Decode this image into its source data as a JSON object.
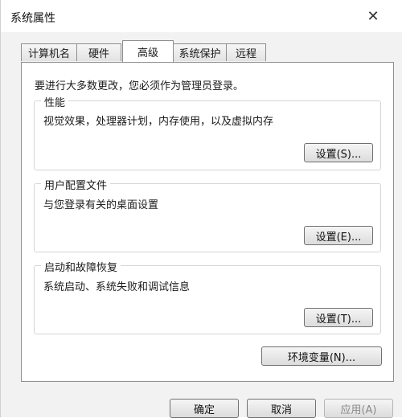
{
  "window": {
    "title": "系统属性",
    "close_glyph": "✕"
  },
  "tabs": [
    {
      "label": "计算机名"
    },
    {
      "label": "硬件"
    },
    {
      "label": "高级"
    },
    {
      "label": "系统保护"
    },
    {
      "label": "远程"
    }
  ],
  "active_tab": "高级",
  "note": "要进行大多数更改，您必须作为管理员登录。",
  "groups": {
    "performance": {
      "title": "性能",
      "description": "视觉效果，处理器计划，内存使用，以及虚拟内存",
      "button": "设置(S)..."
    },
    "profiles": {
      "title": "用户配置文件",
      "description": "与您登录有关的桌面设置",
      "button": "设置(E)..."
    },
    "startup": {
      "title": "启动和故障恢复",
      "description": "系统启动、系统失败和调试信息",
      "button": "设置(T)..."
    }
  },
  "env_button": "环境变量(N)...",
  "footer": {
    "ok": "确定",
    "cancel": "取消",
    "apply": "应用(A)"
  }
}
